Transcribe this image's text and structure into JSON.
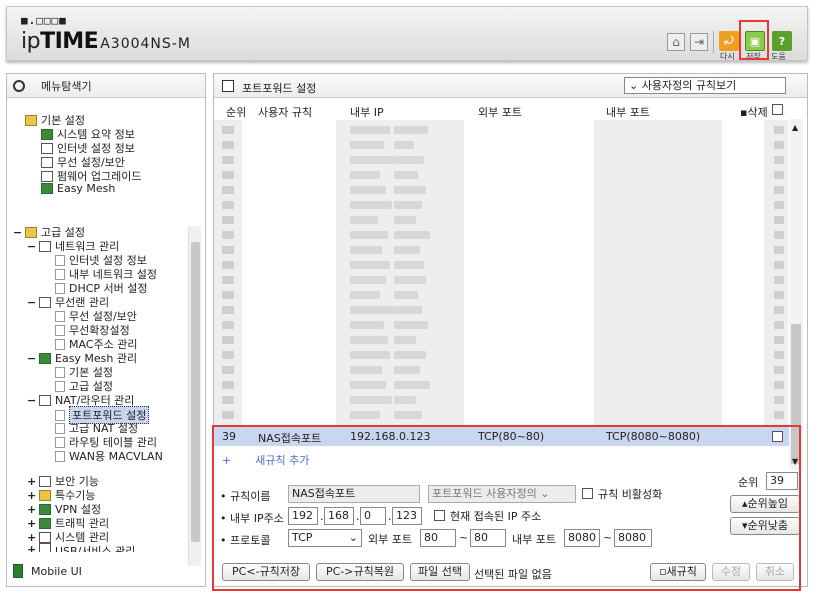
{
  "header": {
    "logo_dots": "■.□□□■",
    "brand_pre": "ip",
    "brand_mid": "TIME",
    "model": "A3004NS-M",
    "buttons": [
      {
        "label": "다시",
        "icon": "refresh-icon",
        "color": "#f0a020"
      },
      {
        "label": "저장",
        "icon": "save-icon",
        "color": "#7cc142"
      },
      {
        "label": "도움",
        "icon": "help-icon",
        "color": "#5aa02c"
      }
    ]
  },
  "sidebar": {
    "title": "메뉴탐색기",
    "basic": {
      "label": "기본 설정",
      "items": [
        "시스템 요약 정보",
        "인터넷 설정 정보",
        "무선 설정/보안",
        "펌웨어 업그레이드",
        "Easy Mesh"
      ]
    },
    "advanced": {
      "label": "고급 설정",
      "groups": [
        {
          "label": "네트워크 관리",
          "items": [
            "인터넷 설정 정보",
            "내부 네트워크 설정",
            "DHCP 서버 설정"
          ]
        },
        {
          "label": "무선랜 관리",
          "items": [
            "무선 설정/보안",
            "무선확장설정",
            "MAC주소 관리"
          ]
        },
        {
          "label": "Easy Mesh 관리",
          "items": [
            "기본 설정",
            "고급 설정"
          ]
        },
        {
          "label": "NAT/라우터 관리",
          "items": [
            "포트포워드 설정",
            "고급 NAT 설정",
            "라우팅 테이블 관리",
            "WAN용 MACVLAN"
          ]
        }
      ],
      "collapsed": [
        "보안 기능",
        "특수기능",
        "VPN 설정",
        "트래픽 관리",
        "시스템 관리",
        "USB/서비스 관리"
      ]
    },
    "mobile": "Mobile UI"
  },
  "main": {
    "title": "포트포워드 설정",
    "view_select": "사용자정의 규칙보기",
    "columns": [
      "순위",
      "사용자 규칙",
      "내부 IP",
      "외부 포트",
      "내부 포트",
      "삭제"
    ],
    "selected_row": {
      "rank": "39",
      "name": "NAS접속포트",
      "ip": "192.168.0.123",
      "ext": "TCP(80~80)",
      "int": "TCP(8080~8080)"
    },
    "add_rule": "새규칙 추가",
    "form": {
      "rank_label": "순위",
      "rank_value": "39",
      "name_label": "규칙이름",
      "name_value": "NAS접속포트",
      "template_value": "포트포워드 사용자정의",
      "disable_label": "규칙 비활성화",
      "ip_label": "내부 IP주소",
      "ip": [
        "192",
        "168",
        "0",
        "123"
      ],
      "current_ip_label": "현재 접속된 IP 주소",
      "proto_label": "프로토콜",
      "proto_value": "TCP",
      "ext_label": "외부 포트",
      "ext_from": "80",
      "ext_to": "80",
      "int_label": "내부 포트",
      "int_from": "8080",
      "int_to": "8080",
      "rank_up": "순위높임",
      "rank_down": "순위낮춤",
      "btn_save_pc": "PC<-규칙저장",
      "btn_restore_pc": "PC->규칙복원",
      "btn_file": "파일 선택",
      "no_file": "선택된 파일 없음",
      "btn_new": "새규칙",
      "btn_edit": "수정",
      "btn_cancel": "취소"
    }
  }
}
